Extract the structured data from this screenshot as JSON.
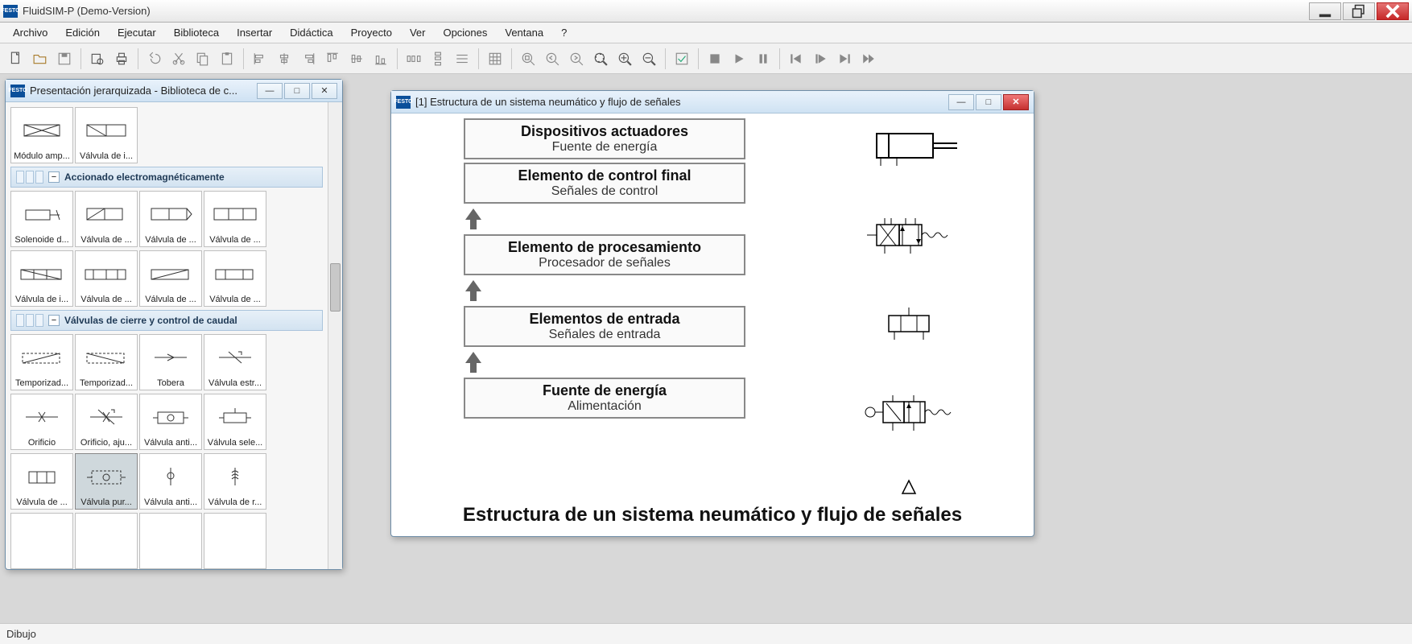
{
  "app": {
    "title": "FluidSIM-P (Demo-Version)",
    "icon_label": "FESTO"
  },
  "menu": [
    "Archivo",
    "Edición",
    "Ejecutar",
    "Biblioteca",
    "Insertar",
    "Didáctica",
    "Proyecto",
    "Ver",
    "Opciones",
    "Ventana",
    "?"
  ],
  "statusbar": {
    "text": "Dibujo"
  },
  "library_panel": {
    "title": "Presentación jerarquizada - Biblioteca de c...",
    "row0": [
      {
        "label": "Módulo amp..."
      },
      {
        "label": "Válvula de i..."
      }
    ],
    "cat1": {
      "name": "Accionado electromagnéticamente"
    },
    "row1": [
      {
        "label": "Solenoide d..."
      },
      {
        "label": "Válvula de ..."
      },
      {
        "label": "Válvula de ..."
      },
      {
        "label": "Válvula de ..."
      }
    ],
    "row2": [
      {
        "label": "Válvula de i..."
      },
      {
        "label": "Válvula de ..."
      },
      {
        "label": "Válvula de ..."
      },
      {
        "label": "Válvula de ..."
      }
    ],
    "cat2": {
      "name": "Válvulas de cierre y control de caudal"
    },
    "row3": [
      {
        "label": "Temporizad..."
      },
      {
        "label": "Temporizad..."
      },
      {
        "label": "Tobera"
      },
      {
        "label": "Válvula estr..."
      }
    ],
    "row4": [
      {
        "label": "Orificio"
      },
      {
        "label": "Orificio, aju..."
      },
      {
        "label": "Válvula anti..."
      },
      {
        "label": "Válvula sele..."
      }
    ],
    "row5": [
      {
        "label": "Válvula de ..."
      },
      {
        "label": "Válvula pur...",
        "selected": true
      },
      {
        "label": "Válvula anti..."
      },
      {
        "label": "Válvula de r..."
      }
    ]
  },
  "diagram": {
    "title": "[1] Estructura de un sistema neumático y flujo de señales",
    "caption": "Estructura de un sistema neumático y flujo de señales",
    "boxes": [
      {
        "t1": "Dispositivos actuadores",
        "t2": "Fuente de energía"
      },
      {
        "t1": "Elemento de control final",
        "t2": "Señales de control"
      },
      {
        "t1": "Elemento de procesamiento",
        "t2": "Procesador de señales"
      },
      {
        "t1": "Elementos de entrada",
        "t2": "Señales de entrada"
      },
      {
        "t1": "Fuente de energía",
        "t2": "Alimentación"
      }
    ]
  }
}
